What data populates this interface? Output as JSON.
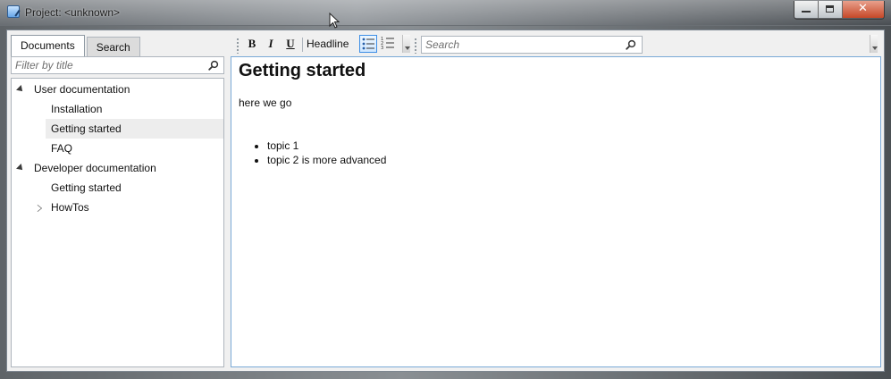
{
  "window": {
    "title": "Project: <unknown>",
    "close_glyph": "✕"
  },
  "left_panel": {
    "tabs": [
      {
        "label": "Documents",
        "active": true
      },
      {
        "label": "Search",
        "active": false
      }
    ],
    "filter": {
      "placeholder": "Filter by title",
      "value": ""
    },
    "tree": [
      {
        "label": "User documentation",
        "level": 0,
        "state": "expanded"
      },
      {
        "label": "Installation",
        "level": 1,
        "state": "leaf"
      },
      {
        "label": "Getting started",
        "level": 1,
        "state": "selected"
      },
      {
        "label": "FAQ",
        "level": 1,
        "state": "leaf"
      },
      {
        "label": "Developer documentation",
        "level": 0,
        "state": "expanded"
      },
      {
        "label": "Getting started",
        "level": 1,
        "state": "leaf"
      },
      {
        "label": "HowTos",
        "level": 1,
        "state": "collapsed"
      }
    ]
  },
  "toolbar": {
    "bold_label": "B",
    "italic_label": "I",
    "underline_label": "U",
    "headline_label": "Headline",
    "search_placeholder": "Search",
    "search_value": ""
  },
  "editor": {
    "heading": "Getting started",
    "paragraph": "here we go",
    "bullets": [
      "topic 1",
      "topic 2 is more advanced"
    ]
  },
  "icons": {
    "window_icon": "edit-document-icon",
    "minimize_icon": "minimize-icon",
    "maximize_icon": "maximize-icon",
    "close_icon": "close-icon",
    "filter_icon": "search-icon",
    "toolbar_search_icon": "search-icon",
    "bullet_list_icon": "bullet-list-icon",
    "numbered_list_icon": "numbered-list-icon"
  },
  "colors": {
    "accent": "#3d8ee6",
    "editor_border": "#7aa9d7",
    "selection": "#ededed"
  }
}
